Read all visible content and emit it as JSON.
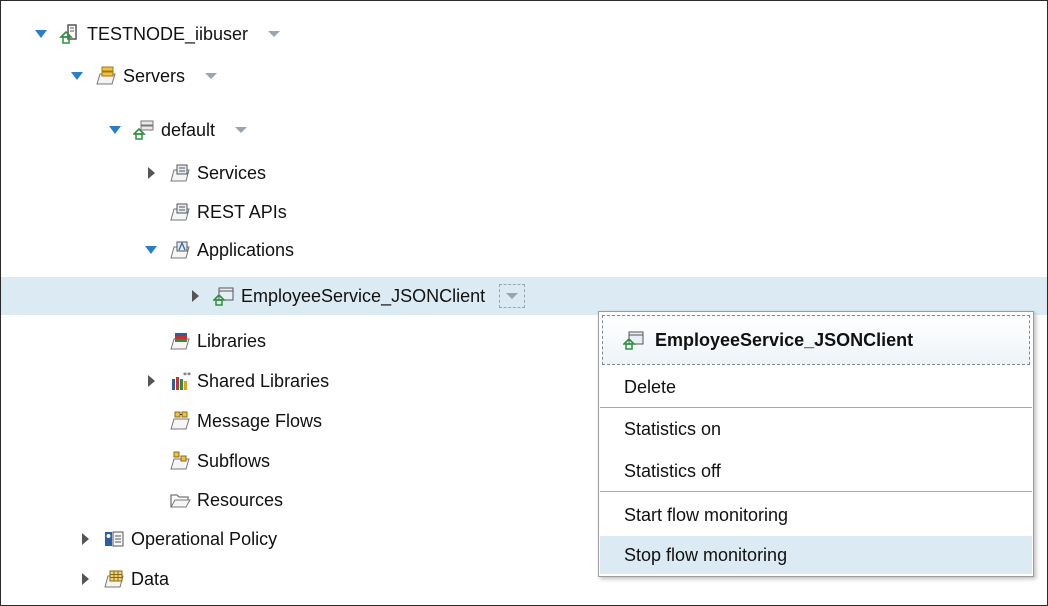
{
  "tree": {
    "node": "TESTNODE_iibuser",
    "servers": "Servers",
    "server_default": "default",
    "services": "Services",
    "rest_apis": "REST APIs",
    "applications": "Applications",
    "application_item": "EmployeeService_JSONClient",
    "libraries": "Libraries",
    "shared_libraries": "Shared Libraries",
    "message_flows": "Message Flows",
    "subflows": "Subflows",
    "resources": "Resources",
    "operational_policy": "Operational Policy",
    "data": "Data"
  },
  "context_menu": {
    "title": "EmployeeService_JSONClient",
    "items": {
      "delete": "Delete",
      "statistics_on": "Statistics on",
      "statistics_off": "Statistics off",
      "start_flow_monitoring": "Start flow monitoring",
      "stop_flow_monitoring": "Stop flow monitoring"
    }
  },
  "colors": {
    "selection": "#dcebf3",
    "twisty_expanded": "#2a7fc4",
    "twisty_collapsed": "#555555",
    "icon_green": "#2f8f3f",
    "icon_gray": "#6f6f6f"
  }
}
